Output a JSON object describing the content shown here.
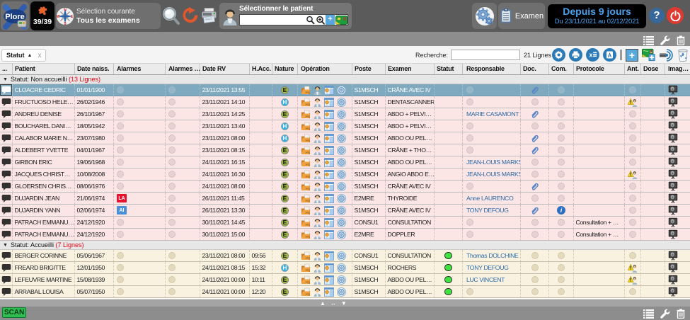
{
  "topbar": {
    "logo_text": "Plore",
    "plugin_count": "39/39",
    "selection_title": "Sélection courante",
    "selection_subtitle": "Tous les examens",
    "patient_label": "Sélectionner le patient",
    "patient_input_value": "",
    "exam_button_label": "Examen",
    "period_title": "Depuis 9 jours",
    "period_range": "Du 23/11/2021 au 02/12/2021",
    "help_label": "?"
  },
  "filters": {
    "sort_chip_label": "Statut",
    "sort_chip_arrow": "▲",
    "sort_chip_close": "x",
    "search_label": "Recherche:",
    "search_value": "",
    "row_count": "21 Lignes"
  },
  "colors": {
    "selected_row": "#7ea9be",
    "group_pink_row": "#fbe5e5",
    "group_cream_row": "#f9f2e1",
    "alarm_la_red": "#e8112d",
    "alarm_ai_blue": "#4a90d9",
    "nature_e_green": "#a2bc45",
    "nature_h_blue": "#2fb0e8",
    "status_green": "#3fe23f",
    "link_blue": "#2a6aa8",
    "count_red": "#e20613",
    "period_blue": "#4aa3f0",
    "scan_green": "#2fbd52"
  },
  "table": {
    "columns": [
      "...",
      "Patient",
      "Date naiss.",
      "Alarmes",
      "Alarmes …",
      "Date RV",
      "H.Acc.",
      "Nature",
      "Opération",
      "Poste",
      "Examen",
      "Statut",
      "Responsable",
      "Doc.",
      "Com.",
      "Protocole",
      "Ant.",
      "Dose",
      "Imag…"
    ],
    "groups": [
      {
        "label": "Statut: Non accueilli",
        "count": "(13 Lignes)",
        "style": "pink",
        "rows": [
          {
            "patient": "CLOACRE CEDRIC",
            "birth": "01/01/1900",
            "alarm": "circle",
            "alarm2": "circle",
            "date_rv": "23/11/2021 13:55",
            "hacc": "",
            "nature": "E",
            "poste": "S1MSCH",
            "examen": "CRÂNE AVEC IV",
            "statut": "",
            "responsable": "",
            "doc": "clip",
            "com": "circle",
            "protocole": "",
            "ant": "circle",
            "dose": "",
            "selected": true
          },
          {
            "patient": "FRUCTUOSO HELE…",
            "birth": "26/02/1946",
            "alarm": "circle",
            "alarm2": "circle",
            "date_rv": "23/11/2021 14:10",
            "hacc": "",
            "nature": "H",
            "poste": "S1MSCH",
            "examen": "DENTASCANNER",
            "statut": "",
            "responsable": "",
            "doc": "circle",
            "com": "circle",
            "protocole": "",
            "ant": "warning",
            "dose": ""
          },
          {
            "patient": "ANDREU DENISE",
            "birth": "26/10/1967",
            "alarm": "circle",
            "alarm2": "circle",
            "date_rv": "23/11/2021 14:25",
            "hacc": "",
            "nature": "E",
            "poste": "S1MSCH",
            "examen": "ABDO + PELVI…",
            "statut": "",
            "responsable": "MARIE CASAMONT",
            "doc": "clip",
            "com": "circle",
            "protocole": "",
            "ant": "circle",
            "dose": ""
          },
          {
            "patient": "BOUCHAREL DANI…",
            "birth": "18/05/1942",
            "alarm": "circle",
            "alarm2": "circle",
            "date_rv": "23/11/2021 13:40",
            "hacc": "",
            "nature": "H",
            "poste": "S1MSCH",
            "examen": "ABDO + PELVI…",
            "statut": "",
            "responsable": "",
            "doc": "circle",
            "com": "circle",
            "protocole": "",
            "ant": "circle",
            "dose": ""
          },
          {
            "patient": "CALABOR MARIE N…",
            "birth": "23/07/1980",
            "alarm": "circle",
            "alarm2": "circle",
            "date_rv": "23/11/2021 08:00",
            "hacc": "",
            "nature": "H",
            "poste": "S1MSCH",
            "examen": "ABDO OU PEL…",
            "statut": "",
            "responsable": "",
            "doc": "clip",
            "com": "circle",
            "protocole": "",
            "ant": "circle",
            "dose": ""
          },
          {
            "patient": "ALDEBERT YVETTE",
            "birth": "04/01/1967",
            "alarm": "circle",
            "alarm2": "circle",
            "date_rv": "23/11/2021 08:15",
            "hacc": "",
            "nature": "E",
            "poste": "S1MSCH",
            "examen": "CRÂNE + THO…",
            "statut": "",
            "responsable": "",
            "doc": "clip",
            "com": "circle",
            "protocole": "",
            "ant": "circle",
            "dose": ""
          },
          {
            "patient": "GIRBON ERIC",
            "birth": "19/06/1968",
            "alarm": "circle",
            "alarm2": "circle",
            "date_rv": "24/11/2021 16:15",
            "hacc": "",
            "nature": "E",
            "poste": "S1MSCH",
            "examen": "ABDO OU PEL…",
            "statut": "",
            "responsable": "JEAN-LOUIS MARKS",
            "doc": "circle",
            "com": "circle",
            "protocole": "",
            "ant": "circle",
            "dose": ""
          },
          {
            "patient": "JACQUES CHRIST…",
            "birth": "10/08/2008",
            "alarm": "circle",
            "alarm2": "circle",
            "date_rv": "24/11/2021 16:30",
            "hacc": "",
            "nature": "E",
            "poste": "S1MSCH",
            "examen": "ANGIO ABDO E…",
            "statut": "",
            "responsable": "JEAN-LOUIS MARKS",
            "doc": "circle",
            "com": "circle",
            "protocole": "",
            "ant": "warning",
            "dose": ""
          },
          {
            "patient": "GLOERSEN CHRIS…",
            "birth": "08/06/1976",
            "alarm": "circle",
            "alarm2": "circle",
            "date_rv": "24/11/2021 08:00",
            "hacc": "",
            "nature": "E",
            "poste": "S1MSCH",
            "examen": "CRÂNE AVEC IV",
            "statut": "",
            "responsable": "",
            "doc": "clip",
            "com": "circle",
            "protocole": "",
            "ant": "circle",
            "dose": ""
          },
          {
            "patient": "DUJARDIN JEAN",
            "birth": "21/06/1974",
            "alarm": "LA",
            "alarm2": "circle",
            "date_rv": "26/11/2021 11:45",
            "hacc": "",
            "nature": "E",
            "poste": "E2MRE",
            "examen": "THYROIDE",
            "statut": "",
            "responsable": "Anne LAURENCO",
            "doc": "circle",
            "com": "circle",
            "protocole": "",
            "ant": "circle",
            "dose": ""
          },
          {
            "patient": "DUJARDIN YANN",
            "birth": "02/06/1974",
            "alarm": "AI",
            "alarm2": "circle",
            "date_rv": "26/11/2021 13:30",
            "hacc": "",
            "nature": "E",
            "poste": "S1MSCH",
            "examen": "CRÂNE AVEC IV",
            "statut": "",
            "responsable": "TONY DEFOUG",
            "doc": "clip",
            "com": "info",
            "protocole": "",
            "ant": "circle",
            "dose": ""
          },
          {
            "patient": "PATRACH EMMANU…",
            "birth": "24/12/1920",
            "alarm": "circle",
            "alarm2": "circle",
            "date_rv": "30/11/2021 14:45",
            "hacc": "",
            "nature": "E",
            "poste": "CONSU1",
            "examen": "CONSULTATION",
            "statut": "",
            "responsable": "",
            "doc": "circle",
            "com": "circle",
            "protocole": "Consultation + …",
            "ant": "circle",
            "dose": ""
          },
          {
            "patient": "PATRACH EMMANU…",
            "birth": "24/12/1920",
            "alarm": "circle",
            "alarm2": "circle",
            "date_rv": "30/11/2021 15:00",
            "hacc": "",
            "nature": "E",
            "poste": "E2MRE",
            "examen": "DOPPLER",
            "statut": "",
            "responsable": "",
            "doc": "circle",
            "com": "circle",
            "protocole": "Consultation + …",
            "ant": "circle",
            "dose": ""
          }
        ]
      },
      {
        "label": "Statut: Accueilli",
        "count": "(7 Lignes)",
        "style": "cream",
        "rows": [
          {
            "patient": "BERGER CORINNE",
            "birth": "05/06/1967",
            "alarm": "circle",
            "alarm2": "circle",
            "date_rv": "23/11/2021 08:00",
            "hacc": "09:56",
            "nature": "E",
            "poste": "CONSU1",
            "examen": "CONSULTATION",
            "statut": "green",
            "responsable": "Thomas DOLCHINE",
            "doc": "circle",
            "com": "circle",
            "protocole": "",
            "ant": "circle",
            "dose": ""
          },
          {
            "patient": "FREARD BRIGITTE",
            "birth": "12/01/1950",
            "alarm": "circle",
            "alarm2": "circle",
            "date_rv": "24/11/2021 08:15",
            "hacc": "15:32",
            "nature": "H",
            "poste": "S1MSCH",
            "examen": "ROCHERS",
            "statut": "green",
            "responsable": "TONY DEFOUG",
            "doc": "circle",
            "com": "circle",
            "protocole": "",
            "ant": "warning",
            "dose": ""
          },
          {
            "patient": "LEFEUVRE MARTINE",
            "birth": "15/08/1939",
            "alarm": "circle",
            "alarm2": "circle",
            "date_rv": "24/11/2021 00:00",
            "hacc": "10:11",
            "nature": "E",
            "poste": "S1MSCH",
            "examen": "ABDO OU PEL…",
            "statut": "green",
            "responsable": "LUC VINCENT",
            "doc": "circle",
            "com": "circle",
            "protocole": "",
            "ant": "warning",
            "dose": ""
          },
          {
            "patient": "ARRABAL LOUISA",
            "birth": "05/07/1950",
            "alarm": "circle",
            "alarm2": "circle",
            "date_rv": "24/11/2021 00:00",
            "hacc": "12:20",
            "nature": "E",
            "poste": "S1MSCH",
            "examen": "ABDO OU PEL…",
            "statut": "green",
            "responsable": "",
            "doc": "circle",
            "com": "circle",
            "protocole": "",
            "ant": "circle",
            "dose": ""
          }
        ]
      }
    ]
  },
  "bottombar": {
    "scan_label": "SCAN"
  }
}
